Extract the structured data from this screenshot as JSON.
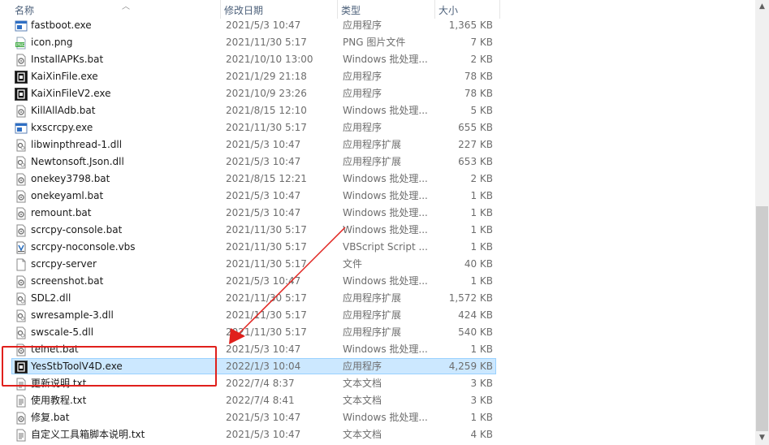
{
  "columns": {
    "name": "名称",
    "modified": "修改日期",
    "type": "类型",
    "size": "大小"
  },
  "annotation_color": "#e0201c",
  "files": [
    {
      "name": "fastboot.exe",
      "date": "2021/5/3 10:47",
      "type": "应用程序",
      "size": "1,365 KB",
      "icon": "exe-window-icon"
    },
    {
      "name": "icon.png",
      "date": "2021/11/30 5:17",
      "type": "PNG 图片文件",
      "size": "7 KB",
      "icon": "png-image-icon"
    },
    {
      "name": "InstallAPKs.bat",
      "date": "2021/10/10 13:00",
      "type": "Windows 批处理...",
      "size": "2 KB",
      "icon": "bat-gear-icon"
    },
    {
      "name": "KaiXinFile.exe",
      "date": "2021/1/29 21:18",
      "type": "应用程序",
      "size": "78 KB",
      "icon": "exe-black-icon"
    },
    {
      "name": "KaiXinFileV2.exe",
      "date": "2021/10/9 23:26",
      "type": "应用程序",
      "size": "78 KB",
      "icon": "exe-black-icon"
    },
    {
      "name": "KillAllAdb.bat",
      "date": "2021/8/15 12:10",
      "type": "Windows 批处理...",
      "size": "5 KB",
      "icon": "bat-gear-icon"
    },
    {
      "name": "kxscrcpy.exe",
      "date": "2021/11/30 5:17",
      "type": "应用程序",
      "size": "655 KB",
      "icon": "exe-window-icon"
    },
    {
      "name": "libwinpthread-1.dll",
      "date": "2021/5/3 10:47",
      "type": "应用程序扩展",
      "size": "227 KB",
      "icon": "dll-gear-icon"
    },
    {
      "name": "Newtonsoft.Json.dll",
      "date": "2021/5/3 10:47",
      "type": "应用程序扩展",
      "size": "653 KB",
      "icon": "dll-gear-icon"
    },
    {
      "name": "onekey3798.bat",
      "date": "2021/8/15 12:21",
      "type": "Windows 批处理...",
      "size": "2 KB",
      "icon": "bat-gear-icon"
    },
    {
      "name": "onekeyaml.bat",
      "date": "2021/5/3 10:47",
      "type": "Windows 批处理...",
      "size": "1 KB",
      "icon": "bat-gear-icon"
    },
    {
      "name": "remount.bat",
      "date": "2021/5/3 10:47",
      "type": "Windows 批处理...",
      "size": "1 KB",
      "icon": "bat-gear-icon"
    },
    {
      "name": "scrcpy-console.bat",
      "date": "2021/11/30 5:17",
      "type": "Windows 批处理...",
      "size": "1 KB",
      "icon": "bat-gear-icon"
    },
    {
      "name": "scrcpy-noconsole.vbs",
      "date": "2021/11/30 5:17",
      "type": "VBScript Script ...",
      "size": "1 KB",
      "icon": "vbs-script-icon"
    },
    {
      "name": "scrcpy-server",
      "date": "2021/11/30 5:17",
      "type": "文件",
      "size": "40 KB",
      "icon": "blank-file-icon"
    },
    {
      "name": "screenshot.bat",
      "date": "2021/5/3 10:47",
      "type": "Windows 批处理...",
      "size": "1 KB",
      "icon": "bat-gear-icon"
    },
    {
      "name": "SDL2.dll",
      "date": "2021/11/30 5:17",
      "type": "应用程序扩展",
      "size": "1,572 KB",
      "icon": "dll-gear-icon"
    },
    {
      "name": "swresample-3.dll",
      "date": "2021/11/30 5:17",
      "type": "应用程序扩展",
      "size": "424 KB",
      "icon": "dll-gear-icon"
    },
    {
      "name": "swscale-5.dll",
      "date": "2021/11/30 5:17",
      "type": "应用程序扩展",
      "size": "540 KB",
      "icon": "dll-gear-icon"
    },
    {
      "name": "telnet.bat",
      "date": "2021/5/3 10:47",
      "type": "Windows 批处理...",
      "size": "1 KB",
      "icon": "bat-gear-icon"
    },
    {
      "name": "YesStbToolV4D.exe",
      "date": "2022/1/3 10:04",
      "type": "应用程序",
      "size": "4,259 KB",
      "icon": "exe-black-icon",
      "selected": true
    },
    {
      "name": "更新说明.txt",
      "date": "2022/7/4 8:37",
      "type": "文本文档",
      "size": "3 KB",
      "icon": "txt-doc-icon"
    },
    {
      "name": "使用教程.txt",
      "date": "2022/7/4 8:41",
      "type": "文本文档",
      "size": "3 KB",
      "icon": "txt-doc-icon"
    },
    {
      "name": "修复.bat",
      "date": "2021/5/3 10:47",
      "type": "Windows 批处理...",
      "size": "1 KB",
      "icon": "bat-gear-icon"
    },
    {
      "name": "自定义工具箱脚本说明.txt",
      "date": "2021/5/3 10:47",
      "type": "文本文档",
      "size": "4 KB",
      "icon": "txt-doc-icon"
    }
  ]
}
